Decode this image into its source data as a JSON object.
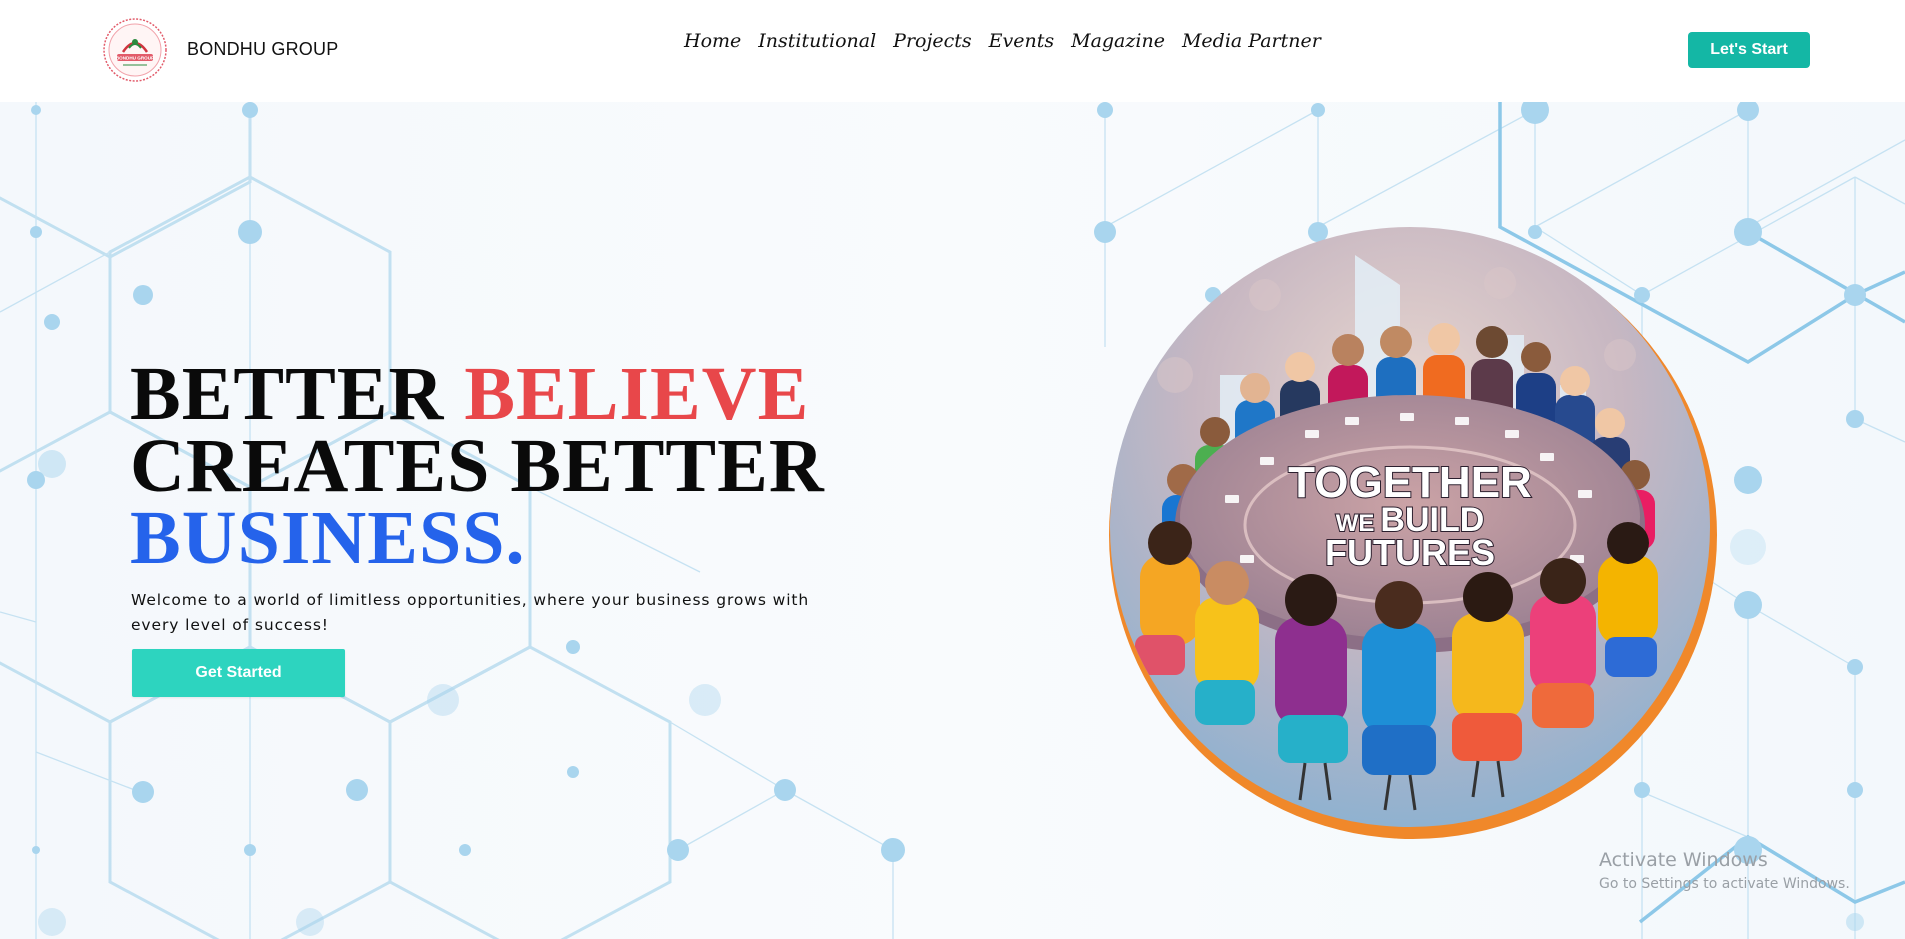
{
  "header": {
    "logo_text": "BONDHU GROUP",
    "brand": "BONDHU GROUP",
    "cta_label": "Let's Start"
  },
  "nav": {
    "items": [
      {
        "label": "Home"
      },
      {
        "label": "Institutional"
      },
      {
        "label": "Projects"
      },
      {
        "label": "Events"
      },
      {
        "label": "Magazine"
      },
      {
        "label": "Media Partner"
      }
    ]
  },
  "hero": {
    "title_line1_a": "BETTER ",
    "title_line1_b": "BELIEVE",
    "title_line2": "CREATES BETTER",
    "title_line3": "BUSINESS.",
    "subtitle": "Welcome to a world of limitless opportunities, where your business grows with every level of success!",
    "button_label": "Get Started",
    "illustration_text": {
      "line1": "TOGETHER",
      "line2a": "WE",
      "line2b": "BUILD",
      "line3": "FUTURES"
    }
  },
  "watermark": {
    "title": "Activate Windows",
    "subtitle": "Go to Settings to activate Windows."
  },
  "colors": {
    "accent_teal": "#14b7a5",
    "button_teal": "#2dd4bf",
    "title_red": "#e8474a",
    "title_blue": "#2563eb",
    "ring_orange": "#f0882a"
  }
}
